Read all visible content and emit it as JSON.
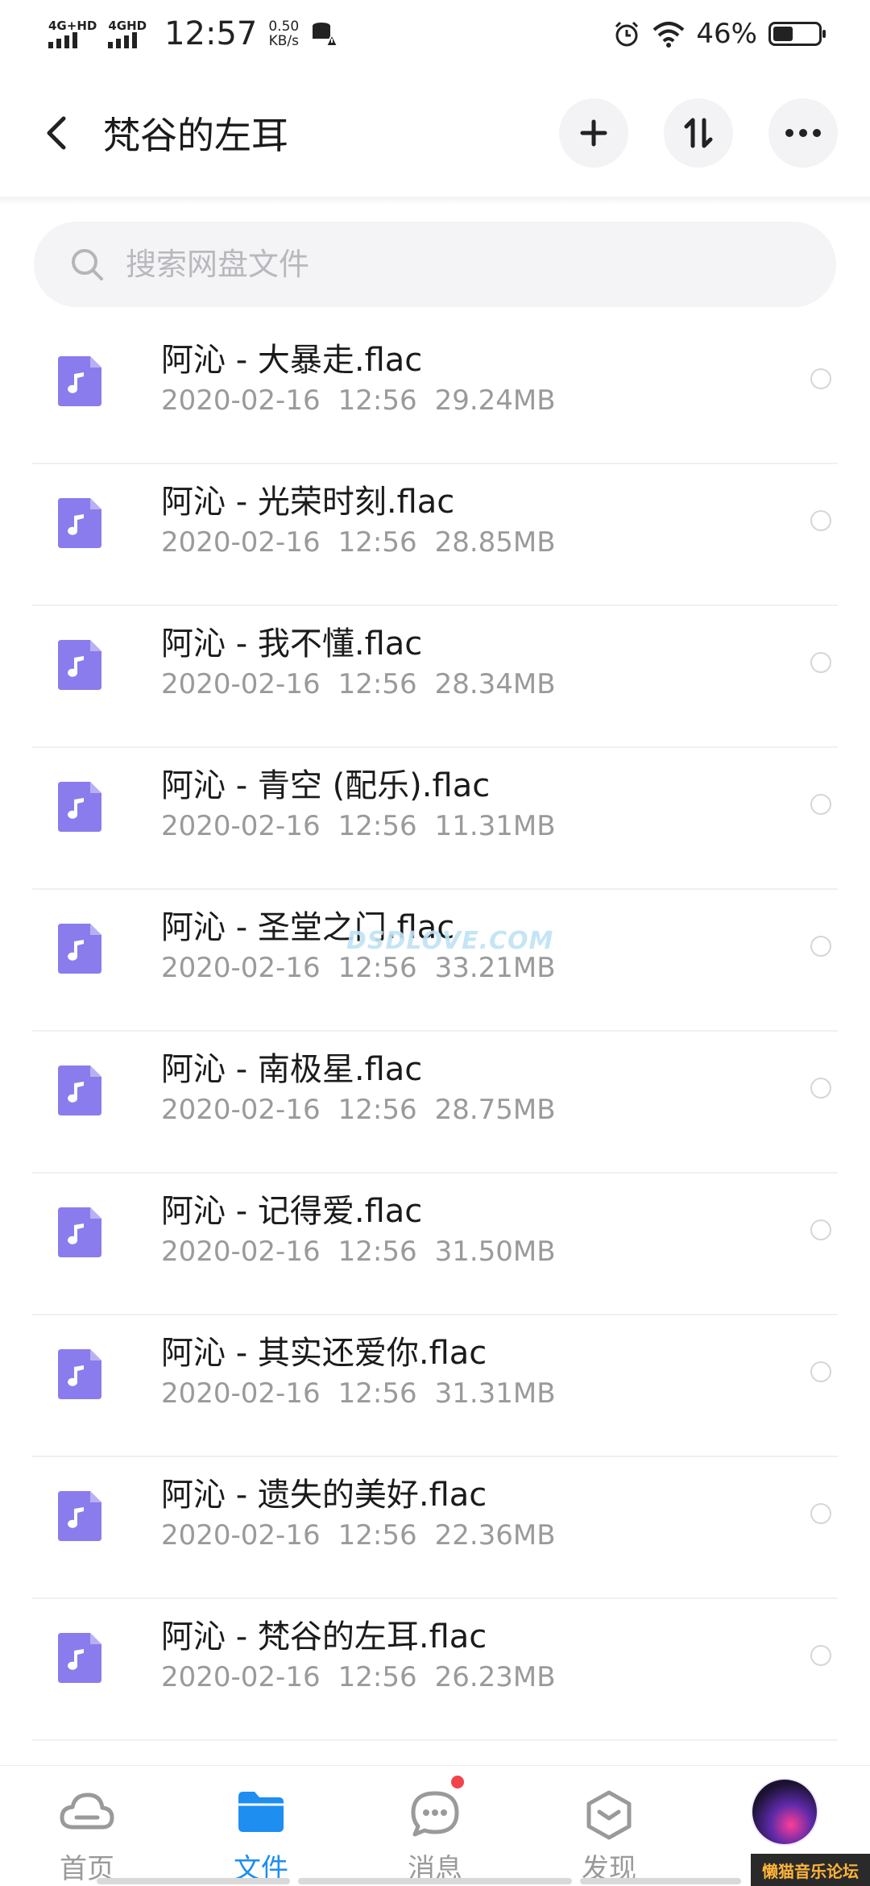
{
  "status_bar": {
    "network1": "4G+HD",
    "network2": "4GHD",
    "time": "12:57",
    "speed_value": "0.50",
    "speed_unit": "KB/s",
    "battery_text": "46%",
    "battery_level": 0.46
  },
  "header": {
    "title": "梵谷的左耳"
  },
  "search": {
    "placeholder": "搜索网盘文件",
    "value": ""
  },
  "files": [
    {
      "name": "阿沁 - 大暴走.flac",
      "date": "2020-02-16",
      "time": "12:56",
      "size": "29.24MB"
    },
    {
      "name": "阿沁 - 光荣时刻.flac",
      "date": "2020-02-16",
      "time": "12:56",
      "size": "28.85MB"
    },
    {
      "name": "阿沁 - 我不懂.flac",
      "date": "2020-02-16",
      "time": "12:56",
      "size": "28.34MB"
    },
    {
      "name": "阿沁 - 青空 (配乐).flac",
      "date": "2020-02-16",
      "time": "12:56",
      "size": "11.31MB"
    },
    {
      "name": "阿沁 - 圣堂之门.flac",
      "date": "2020-02-16",
      "time": "12:56",
      "size": "33.21MB"
    },
    {
      "name": "阿沁 - 南极星.flac",
      "date": "2020-02-16",
      "time": "12:56",
      "size": "28.75MB"
    },
    {
      "name": "阿沁 - 记得爱.flac",
      "date": "2020-02-16",
      "time": "12:56",
      "size": "31.50MB"
    },
    {
      "name": "阿沁 - 其实还爱你.flac",
      "date": "2020-02-16",
      "time": "12:56",
      "size": "31.31MB"
    },
    {
      "name": "阿沁 - 遗失的美好.flac",
      "date": "2020-02-16",
      "time": "12:56",
      "size": "22.36MB"
    },
    {
      "name": "阿沁 - 梵谷的左耳.flac",
      "date": "2020-02-16",
      "time": "12:56",
      "size": "26.23MB"
    }
  ],
  "watermark": "DSDLOVE.COM",
  "bottom_nav": {
    "items": [
      {
        "label": "首页",
        "icon": "cloud-icon"
      },
      {
        "label": "文件",
        "icon": "folder-icon"
      },
      {
        "label": "消息",
        "icon": "chat-icon"
      },
      {
        "label": "发现",
        "icon": "discover-icon"
      }
    ],
    "active": "文件"
  },
  "forum_tag": "懒猫音乐论坛",
  "colors": {
    "accent": "#1e8ef0",
    "file_icon": "#8a7cec",
    "badge": "#f0434a"
  }
}
